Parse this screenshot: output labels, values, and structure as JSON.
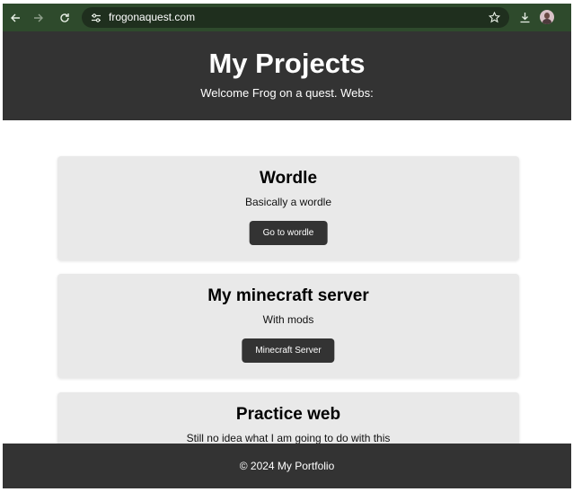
{
  "browser": {
    "url": "frogonaquest.com",
    "icons": {
      "back": "arrow-left-icon",
      "forward": "arrow-right-icon",
      "reload": "reload-icon",
      "site_info": "tune-icon",
      "bookmark": "star-icon",
      "download": "download-icon",
      "profile": "avatar"
    },
    "colors": {
      "toolbar": "#2e4a2c",
      "omnibox": "#1f2f1e"
    }
  },
  "header": {
    "title": "My Projects",
    "subtitle": "Welcome Frog on a quest. Webs:"
  },
  "projects": [
    {
      "title": "Wordle",
      "description": "Basically a wordle",
      "button_label": "Go to wordle"
    },
    {
      "title": "My minecraft server",
      "description": "With mods",
      "button_label": "Minecraft Server"
    },
    {
      "title": "Practice web",
      "description": "Still no idea what I am going to do with this"
    }
  ],
  "footer": {
    "text": "© 2024 My Portfolio"
  },
  "colors": {
    "header_bg": "#333333",
    "card_bg": "#e9e9e9",
    "button_bg": "#333333"
  }
}
